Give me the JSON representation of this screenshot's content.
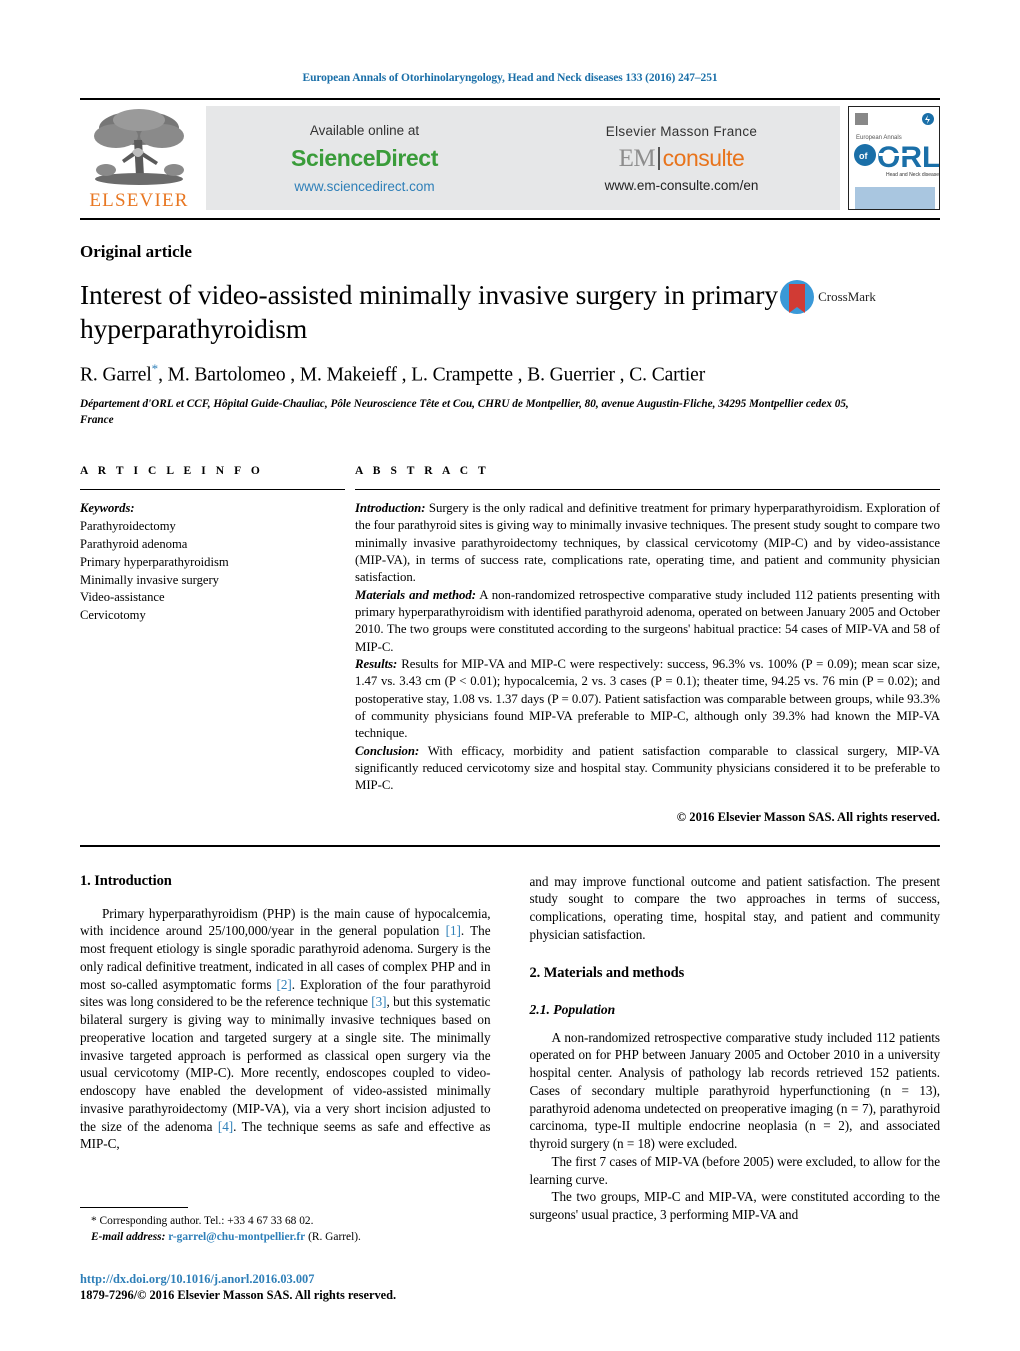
{
  "running_head": "European Annals of Otorhinolaryngology, Head and Neck diseases 133 (2016) 247–251",
  "masthead": {
    "publisher_logo_text": "ELSEVIER",
    "available_online": "Available online at",
    "sciencedirect": "ScienceDirect",
    "sciencedirect_url": "www.sciencedirect.com",
    "elsevier_masson": "Elsevier Masson France",
    "em_prefix": "EM",
    "em_suffix": "consulte",
    "emconsulte_url": "www.em-consulte.com/en",
    "cover_line1": "European Annals",
    "cover_of": "of",
    "cover_orl": "ORL",
    "cover_sub": "Head and Neck diseases"
  },
  "article": {
    "type": "Original article",
    "title": "Interest of video-assisted minimally invasive surgery in primary hyperparathyroidism",
    "crossmark_label": "CrossMark",
    "authors_prefix": "R. Garrel",
    "authors_star": "*",
    "authors_rest": ", M. Bartolomeo , M. Makeieff , L. Crampette , B. Guerrier , C. Cartier",
    "affiliation": "Département d'ORL et CCF, Hôpital Guide-Chauliac, Pôle Neuroscience Tête et Cou, CHRU de Montpellier, 80, avenue Augustin-Fliche, 34295 Montpellier cedex 05, France"
  },
  "article_info": {
    "heading": "A R T I C L E   I N F O",
    "keywords_label": "Keywords:",
    "keywords": [
      "Parathyroidectomy",
      "Parathyroid adenoma",
      "Primary hyperparathyroidism",
      "Minimally invasive surgery",
      "Video-assistance",
      "Cervicotomy"
    ]
  },
  "abstract": {
    "heading": "A B S T R A C T",
    "sections": [
      {
        "lead": "Introduction:",
        "text": " Surgery is the only radical and definitive treatment for primary hyperparathyroidism. Exploration of the four parathyroid sites is giving way to minimally invasive techniques. The present study sought to compare two minimally invasive parathyroidectomy techniques, by classical cervicotomy (MIP-C) and by video-assistance (MIP-VA), in terms of success rate, complications rate, operating time, and patient and community physician satisfaction."
      },
      {
        "lead": "Materials and method:",
        "text": " A non-randomized retrospective comparative study included 112 patients presenting with primary hyperparathyroidism with identified parathyroid adenoma, operated on between January 2005 and October 2010. The two groups were constituted according to the surgeons' habitual practice: 54 cases of MIP-VA and 58 of MIP-C."
      },
      {
        "lead": "Results:",
        "text": " Results for MIP-VA and MIP-C were respectively: success, 96.3% vs. 100% (P = 0.09); mean scar size, 1.47 vs. 3.43 cm (P < 0.01); hypocalcemia, 2 vs. 3 cases (P = 0.1); theater time, 94.25 vs. 76 min (P = 0.02); and postoperative stay, 1.08 vs. 1.37 days (P = 0.07). Patient satisfaction was comparable between groups, while 93.3% of community physicians found MIP-VA preferable to MIP-C, although only 39.3% had known the MIP-VA technique."
      },
      {
        "lead": "Conclusion:",
        "text": " With efficacy, morbidity and patient satisfaction comparable to classical surgery, MIP-VA significantly reduced cervicotomy size and hospital stay. Community physicians considered it to be preferable to MIP-C."
      }
    ],
    "copyright": "© 2016 Elsevier Masson SAS. All rights reserved."
  },
  "body": {
    "left": {
      "intro_heading": "1.  Introduction",
      "paragraph_parts": [
        "Primary hyperparathyroidism (PHP) is the main cause of hypocalcemia, with incidence around 25/100,000/year in the general population ",
        "[1]",
        ". The most frequent etiology is single sporadic parathyroid adenoma. Surgery is the only radical definitive treatment, indicated in all cases of complex PHP and in most so-called asymptomatic forms ",
        "[2]",
        ". Exploration of the four parathyroid sites was long considered to be the reference technique ",
        "[3]",
        ", but this systematic bilateral surgery is giving way to minimally invasive techniques based on preoperative location and targeted surgery at a single site. The minimally invasive targeted approach is performed as classical open surgery via the usual cervicotomy (MIP-C). More recently, endoscopes coupled to video-endoscopy have enabled the development of video-assisted minimally invasive parathyroidectomy (MIP-VA), via a very short incision adjusted to the size of the adenoma ",
        "[4]",
        ". The technique seems as safe and effective as MIP-C,"
      ]
    },
    "right": {
      "continuation": "and may improve functional outcome and patient satisfaction. The present study sought to compare the two approaches in terms of success, complications, operating time, hospital stay, and patient and community physician satisfaction.",
      "methods_heading": "2.  Materials and methods",
      "population_heading": "2.1.  Population",
      "population_p1": "A non-randomized retrospective comparative study included 112 patients operated on for PHP between January 2005 and October 2010 in a university hospital center. Analysis of pathology lab records retrieved 152 patients. Cases of secondary multiple parathyroid hyperfunctioning (n = 13), parathyroid adenoma undetected on preoperative imaging (n = 7), parathyroid carcinoma, type-II multiple endocrine neoplasia (n = 2), and associated thyroid surgery (n = 18) were excluded.",
      "population_p2": "The first 7 cases of MIP-VA (before 2005) were excluded, to allow for the learning curve.",
      "population_p3": "The two groups, MIP-C and MIP-VA, were constituted according to the surgeons' usual practice, 3 performing MIP-VA and"
    }
  },
  "footnote": {
    "corresponding": "*  Corresponding author. Tel.: +33 4 67 33 68 02.",
    "email_label": "E-mail address:",
    "email": "r-garrel@chu-montpellier.fr",
    "email_suffix": " (R. Garrel).",
    "doi": "http://dx.doi.org/10.1016/j.anorl.2016.03.007",
    "issn": "1879-7296/© 2016 Elsevier Masson SAS. All rights reserved."
  },
  "colors": {
    "link": "#2e7fb8",
    "sciencedirect_green": "#3a9c3a",
    "elsevier_orange": "#E87722",
    "em_orange": "#E8741C"
  }
}
